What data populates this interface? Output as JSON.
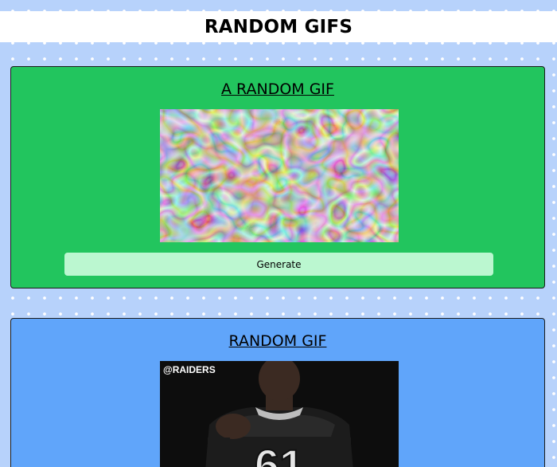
{
  "page": {
    "title": "RANDOM GIFS"
  },
  "cards": [
    {
      "title": "A RANDOM GIF",
      "generate_label": "Generate",
      "bg_color": "#22c55e",
      "image_alt_semantic": "psychedelic-swirl-gif"
    },
    {
      "title": "RANDOM GIF",
      "gif_watermark": "@RAIDERS",
      "bg_color": "#60a5fa",
      "image_alt_semantic": "raiders-player-pointing-gif"
    }
  ],
  "colors": {
    "background": "#b7d2fb",
    "header_bg": "#ffffff",
    "green_card": "#22c55e",
    "blue_card": "#60a5fa",
    "button_bg": "#bbf7d0"
  }
}
